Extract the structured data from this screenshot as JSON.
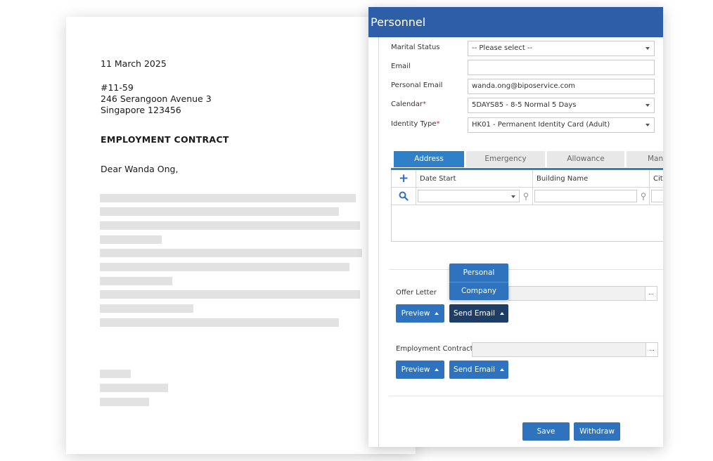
{
  "letter": {
    "date": "11 March 2025",
    "address_line1": "#11-59",
    "address_line2": "246 Serangoon Avenue 3",
    "address_line3": "Singapore 123456",
    "title": "EMPLOYMENT CONTRACT",
    "salutation": "Dear Wanda Ong,"
  },
  "panel": {
    "title": "Personnel",
    "fields": {
      "marital_status": {
        "label": "Marital Status",
        "value": "-- Please select --"
      },
      "email": {
        "label": "Email",
        "value": ""
      },
      "personal_email": {
        "label": "Personal Email",
        "value": "wanda.ong@biposervice.com"
      },
      "calendar": {
        "label": "Calendar",
        "value": "5DAYS85 - 8-5 Normal 5 Days"
      },
      "identity_type": {
        "label": "Identity Type",
        "value": "HK01 - Permanent Identity Card (Adult)"
      }
    },
    "required_marker": "*",
    "tabs": [
      "Address",
      "Emergency",
      "Allowance",
      "Man"
    ],
    "grid": {
      "columns": [
        "Date Start",
        "Building Name",
        "City"
      ]
    },
    "offer_letter": {
      "label": "Offer Letter",
      "preview_label": "Preview",
      "send_email_label": "Send Email",
      "dots": "...",
      "menu": [
        "Personal",
        "Company"
      ]
    },
    "employment_contract": {
      "label": "Employment Contract",
      "preview_label": "Preview",
      "send_email_label": "Send Email",
      "dots": "..."
    },
    "footer": {
      "save_label": "Save",
      "withdraw_label": "Withdraw"
    }
  },
  "colors": {
    "header": "#2e5ea8",
    "accent": "#2f73bf",
    "active_button": "#1e3e66",
    "required": "#c0272d"
  }
}
